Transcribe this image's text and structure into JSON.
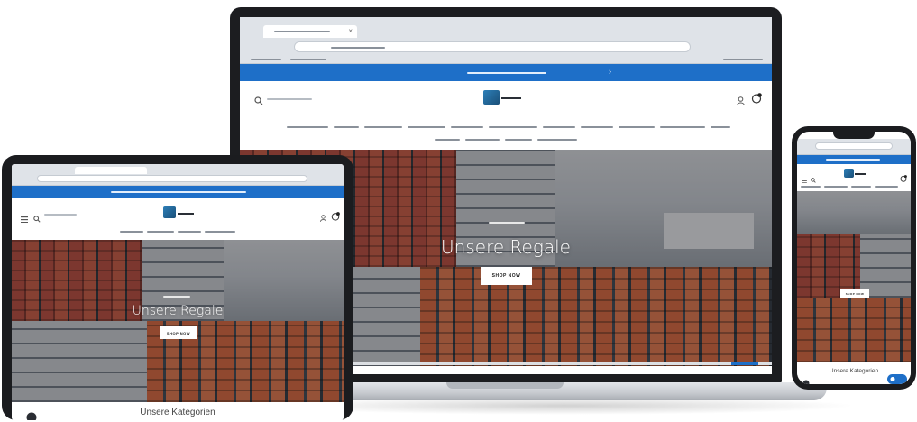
{
  "hero": {
    "headline": "Unsere Regale",
    "cta_label": "SHOP NOW"
  },
  "phone": {
    "section_title": "Unsere Kategorien"
  },
  "tablet": {
    "section_title": "Unsere Kategorien"
  },
  "colors": {
    "announcement_bar": "#1e6fc8",
    "logo": "#2d7fb8",
    "chat_widget": "#1e6fc8"
  },
  "icons": [
    "search-icon",
    "account-icon",
    "cart-icon",
    "menu-icon",
    "chat-icon"
  ]
}
